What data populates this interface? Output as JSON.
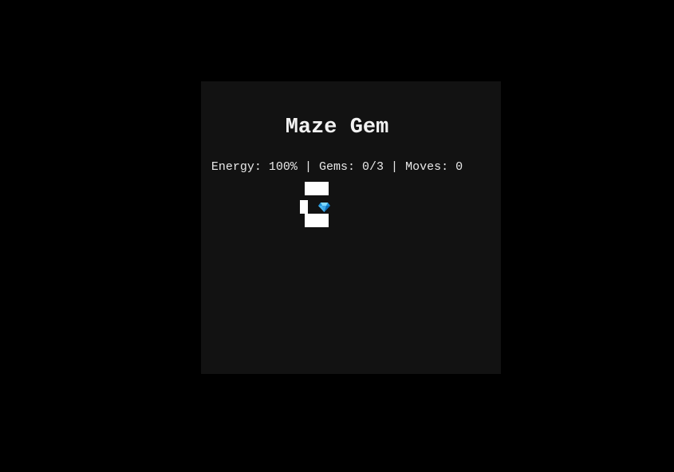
{
  "game": {
    "title": "Maze Gem",
    "status": {
      "energy_label": "Energy:",
      "energy_value": "100%",
      "gems_label": "Gems:",
      "gems_value": "0/3",
      "moves_label": "Moves:",
      "moves_value": "0",
      "separator": "|"
    }
  },
  "colors": {
    "background": "#000000",
    "panel": "#121212",
    "wall": "#ffffff",
    "gem_light": "#7fd8ff",
    "gem_dark": "#1a8fd8"
  },
  "icons": {
    "gem": "gem-icon"
  }
}
